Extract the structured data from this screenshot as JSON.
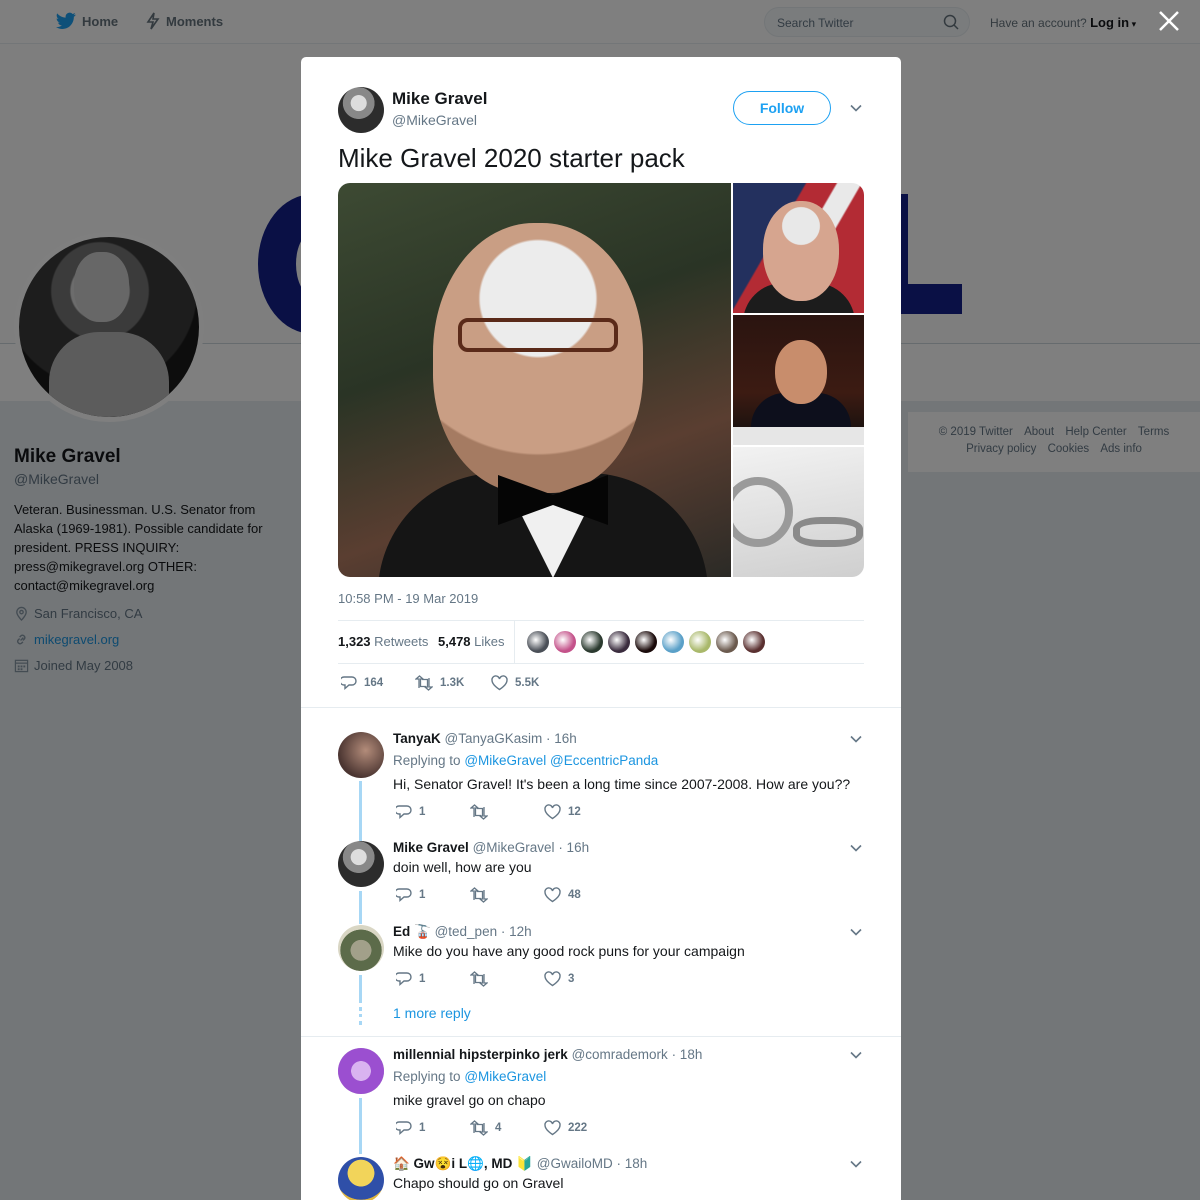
{
  "nav": {
    "home_label": "Home",
    "moments_label": "Moments",
    "search_placeholder": "Search Twitter",
    "account_prompt": "Have an account?",
    "login_label": "Log in"
  },
  "profile": {
    "name": "Mike Gravel",
    "handle": "@MikeGravel",
    "bio": "Veteran. Businessman. U.S. Senator from Alaska (1969-1981). Possible candidate for president. PRESS INQUIRY: press@mikegravel.org OTHER: contact@mikegravel.org",
    "location": "San Francisco, CA",
    "website": "mikegravel.org",
    "joined": "Joined May 2008"
  },
  "footer": {
    "copyright": "© 2019 Twitter",
    "links_row1": [
      "About",
      "Help Center",
      "Terms"
    ],
    "links_row2": [
      "Privacy policy",
      "Cookies",
      "Ads info"
    ]
  },
  "tweet": {
    "author_name": "Mike Gravel",
    "author_handle": "@MikeGravel",
    "follow_label": "Follow",
    "text": "Mike Gravel 2020 starter pack",
    "timestamp": "10:58 PM - 19 Mar 2019",
    "retweets_count": "1,323",
    "retweets_label": "Retweets",
    "likes_count": "5,478",
    "likes_label": "Likes",
    "liker_colors": [
      "#4a4f57",
      "#c4528a",
      "#2b3a2f",
      "#3a2c3e",
      "#1a0a0a",
      "#5aa0c8",
      "#a9b86a",
      "#6b5a4e",
      "#5a3030"
    ],
    "actions": {
      "replies": "164",
      "retweets": "1.3K",
      "likes": "5.5K"
    }
  },
  "replies": [
    {
      "name": "TanyaK",
      "handle": "@TanyaGKasim",
      "time": "· 16h",
      "replying_prefix": "Replying to",
      "mentions": "@MikeGravel @EccentricPanda",
      "text": "Hi, Senator Gravel! It's been a long time since 2007-2008. How are you??",
      "reply_count": "1",
      "retweet_count": "",
      "like_count": "12",
      "avatar_color": "#6b4a45"
    },
    {
      "name": "Mike Gravel",
      "handle": "@MikeGravel",
      "time": "· 16h",
      "text": "doin well, how are you",
      "reply_count": "1",
      "retweet_count": "",
      "like_count": "48",
      "avatar_color": "#3a3a3a"
    },
    {
      "name": "Ed 🚡",
      "handle": "@ted_pen",
      "time": "· 12h",
      "text": "Mike do you have any good rock puns for your campaign",
      "reply_count": "1",
      "retweet_count": "",
      "like_count": "3",
      "avatar_color": "#5c6b4a",
      "more_replies": "1 more reply"
    },
    {
      "name": "millennial hipsterpinko jerk",
      "handle": "@comrademork",
      "time": "· 18h",
      "replying_prefix": "Replying to",
      "mentions": "@MikeGravel",
      "text": "mike gravel go on chapo",
      "reply_count": "1",
      "retweet_count": "4",
      "like_count": "222",
      "avatar_color": "#9b4fd0"
    },
    {
      "name": "🏠 Gw😵i L🌐, MD 🔰",
      "handle": "@GwailoMD",
      "time": "· 18h",
      "text": "Chapo should go on Gravel",
      "avatar_color": "#e0b640"
    }
  ],
  "icons": {
    "home": "bird-logo-icon",
    "moments": "lightning-icon",
    "search": "search-icon",
    "close": "close-icon",
    "caret": "chevron-down-icon",
    "reply": "reply-icon",
    "retweet": "retweet-icon",
    "like": "heart-icon"
  },
  "colors": {
    "accent": "#1da1f2",
    "link": "#1b95e0",
    "muted": "#657786"
  }
}
